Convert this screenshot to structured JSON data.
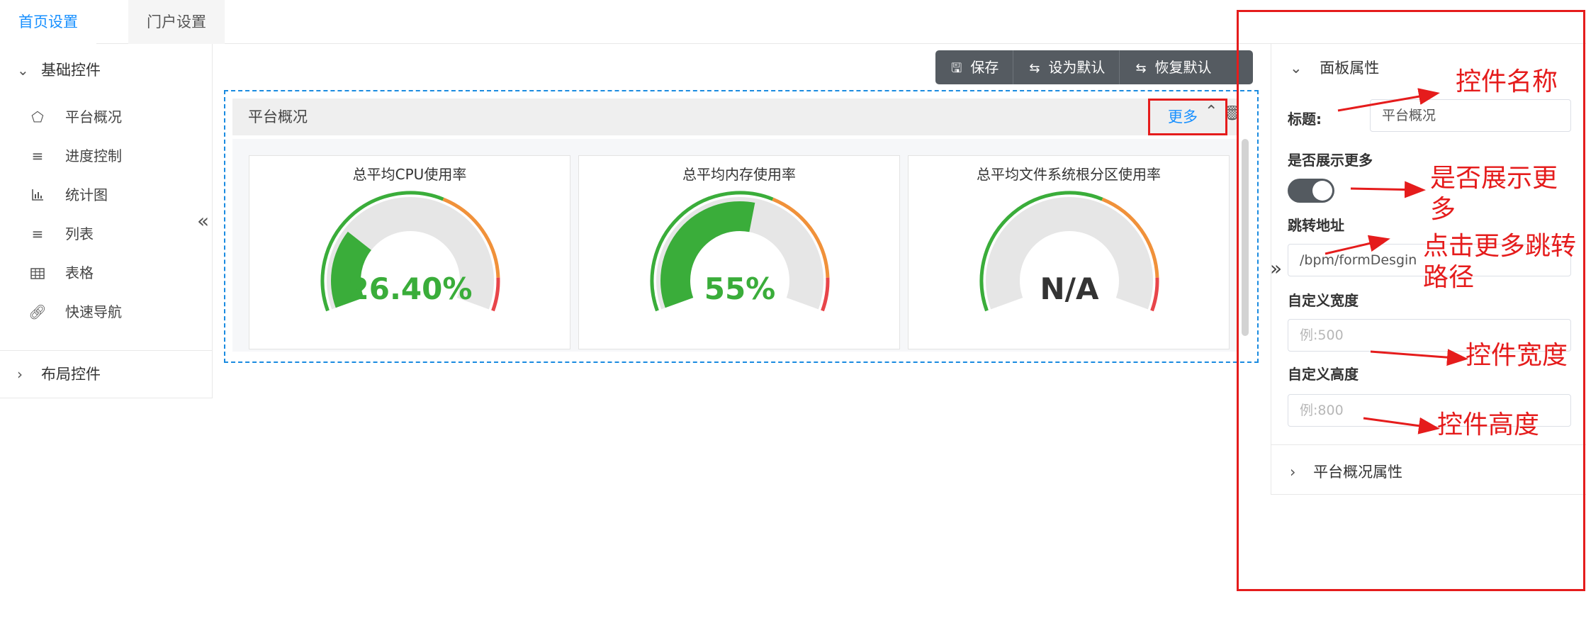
{
  "tabs": [
    {
      "label": "首页设置",
      "active": true
    },
    {
      "label": "门户设置",
      "active": false
    }
  ],
  "left_panel": {
    "basic_group": "基础控件",
    "items": [
      {
        "label": "平台概况",
        "icon": "dashboard-icon"
      },
      {
        "label": "进度控制",
        "icon": "list-ordered-icon"
      },
      {
        "label": "统计图",
        "icon": "bar-chart-icon"
      },
      {
        "label": "列表",
        "icon": "list-icon"
      },
      {
        "label": "表格",
        "icon": "table-icon"
      },
      {
        "label": "快速导航",
        "icon": "link-icon"
      }
    ],
    "layout_group": "布局控件"
  },
  "toolbar": {
    "save": "保存",
    "set_default": "设为默认",
    "restore_default": "恢复默认"
  },
  "panel": {
    "title": "平台概况",
    "more": "更多"
  },
  "chart_data": [
    {
      "type": "gauge",
      "title": "总平均CPU使用率",
      "value": 26.4,
      "label": "26.40%",
      "range": [
        0,
        100
      ]
    },
    {
      "type": "gauge",
      "title": "总平均内存使用率",
      "value": 55,
      "label": "55%",
      "range": [
        0,
        100
      ]
    },
    {
      "type": "gauge",
      "title": "总平均文件系统根分区使用率",
      "value": null,
      "label": "N/A",
      "range": [
        0,
        100
      ]
    }
  ],
  "colors": {
    "gauge_green": "#3aad3a",
    "gauge_orange": "#f0913a",
    "gauge_red": "#e8454a",
    "gauge_track": "#e6e6e6",
    "accent": "#1890ff",
    "annotation": "#e51c1c"
  },
  "right_panel": {
    "header": "面板属性",
    "title_label": "标题:",
    "title_value": "平台概况",
    "show_more_label": "是否展示更多",
    "show_more_on": true,
    "url_label": "跳转地址",
    "url_value": "/bpm/formDesgin",
    "width_label": "自定义宽度",
    "width_placeholder": "例:500",
    "height_label": "自定义高度",
    "height_placeholder": "例:800",
    "sub_header": "平台概况属性"
  },
  "annotations": {
    "name": "控件名称",
    "show_more_1": "是否展示更",
    "show_more_2": "多",
    "path_1": "点击更多跳转",
    "path_2": "路径",
    "width": "控件宽度",
    "height": "控件高度"
  }
}
